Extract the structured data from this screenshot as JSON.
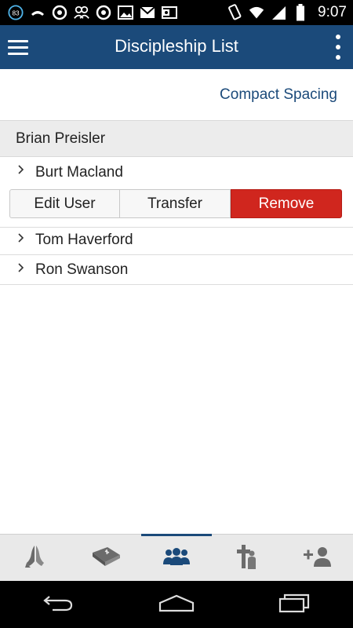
{
  "status_bar": {
    "notification_badge": "83",
    "time": "9:07",
    "left_icons": [
      "notification-count-icon",
      "missed-call-icon",
      "circle-a-icon",
      "people-icon",
      "circle-a-icon",
      "image-icon",
      "gmail-icon",
      "outlook-icon"
    ],
    "right_icons": [
      "vibrate-icon",
      "wifi-icon",
      "signal-icon",
      "battery-icon"
    ]
  },
  "app_bar": {
    "title": "Discipleship List",
    "menu_icon": "hamburger-menu-icon",
    "overflow_icon": "overflow-menu-icon"
  },
  "toolbar": {
    "compact_spacing_label": "Compact Spacing"
  },
  "list": {
    "section_header": "Brian Preisler",
    "rows": [
      {
        "label": "Burt Macland",
        "expanded": true
      },
      {
        "label": "Tom Haverford",
        "expanded": false
      },
      {
        "label": "Ron Swanson",
        "expanded": false
      }
    ],
    "actions": {
      "edit_label": "Edit User",
      "transfer_label": "Transfer",
      "remove_label": "Remove"
    }
  },
  "tabs": [
    {
      "icon": "praying-hands-icon",
      "active": false
    },
    {
      "icon": "bible-icon",
      "active": false
    },
    {
      "icon": "group-icon",
      "active": true
    },
    {
      "icon": "cross-person-icon",
      "active": false
    },
    {
      "icon": "add-person-icon",
      "active": false
    }
  ],
  "nav_bar": [
    "back-icon",
    "home-icon",
    "recents-icon"
  ],
  "colors": {
    "app_bar": "#1b4a7a",
    "accent": "#1b4a7a",
    "remove": "#d0261e",
    "section_header_bg": "#ececec",
    "tab_bar_bg": "#e9e9e9",
    "tab_icon_inactive": "#6b6b6b",
    "tab_icon_active": "#1b4a7a"
  }
}
